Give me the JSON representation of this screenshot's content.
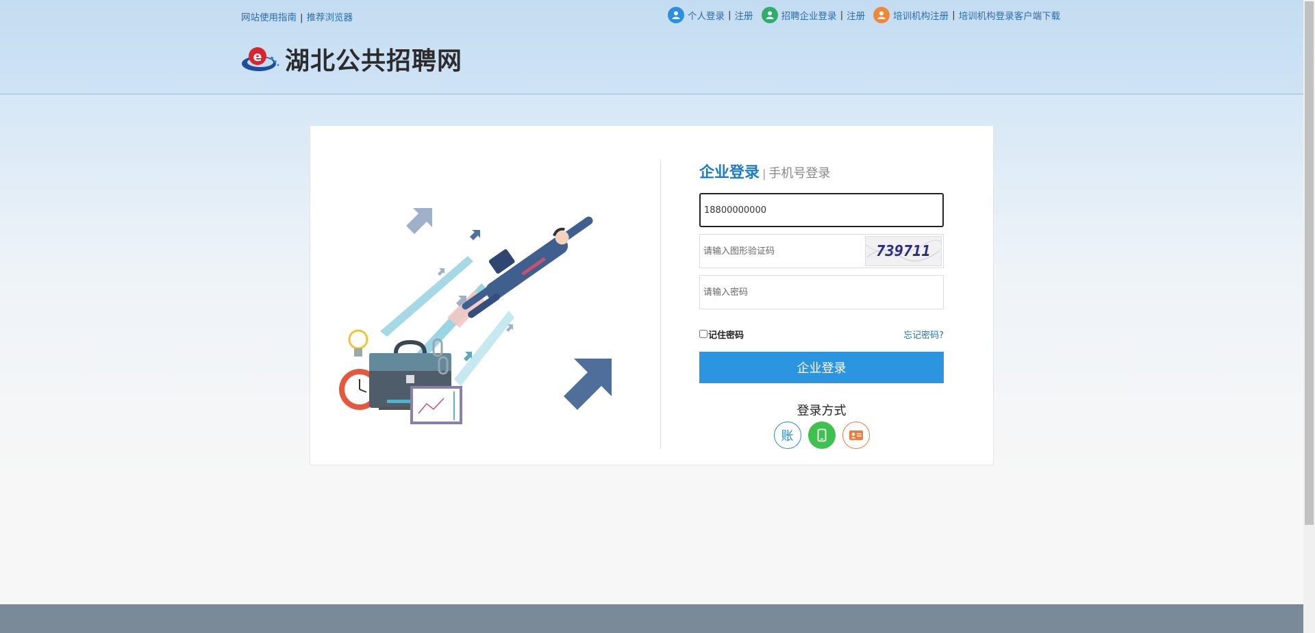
{
  "topnav": {
    "guide": "网站使用指南",
    "browser": "推荐浏览器",
    "personal_login": "个人登录",
    "register1": "注册",
    "company_login": "招聘企业登录",
    "register2": "注册",
    "training_register": "培训机构注册",
    "client_download": "培训机构登录客户端下载",
    "separator": "|"
  },
  "logo": {
    "text": "湖北公共招聘网"
  },
  "login": {
    "tab_active": "企业登录",
    "tab_separator": "|",
    "tab_inactive": "手机号登录",
    "username_value": "18800000000",
    "captcha_placeholder": "请输入图形验证码",
    "captcha_code": "739711",
    "password_placeholder": "请输入密码",
    "remember_label": "记住密码",
    "forgot_label": "忘记密码?",
    "submit_label": "企业登录",
    "methods_title": "登录方式",
    "method_account_char": "账"
  },
  "colors": {
    "primary": "#2b95e0",
    "link": "#2a6db5",
    "tab_active": "#1a7ad0",
    "phone_green": "#3fc04f",
    "id_orange": "#f07a3a",
    "footer": "#7a8a98"
  },
  "icons": [
    "person-blue-icon",
    "person-green-icon",
    "person-orange-icon",
    "phone-icon",
    "id-card-icon"
  ]
}
